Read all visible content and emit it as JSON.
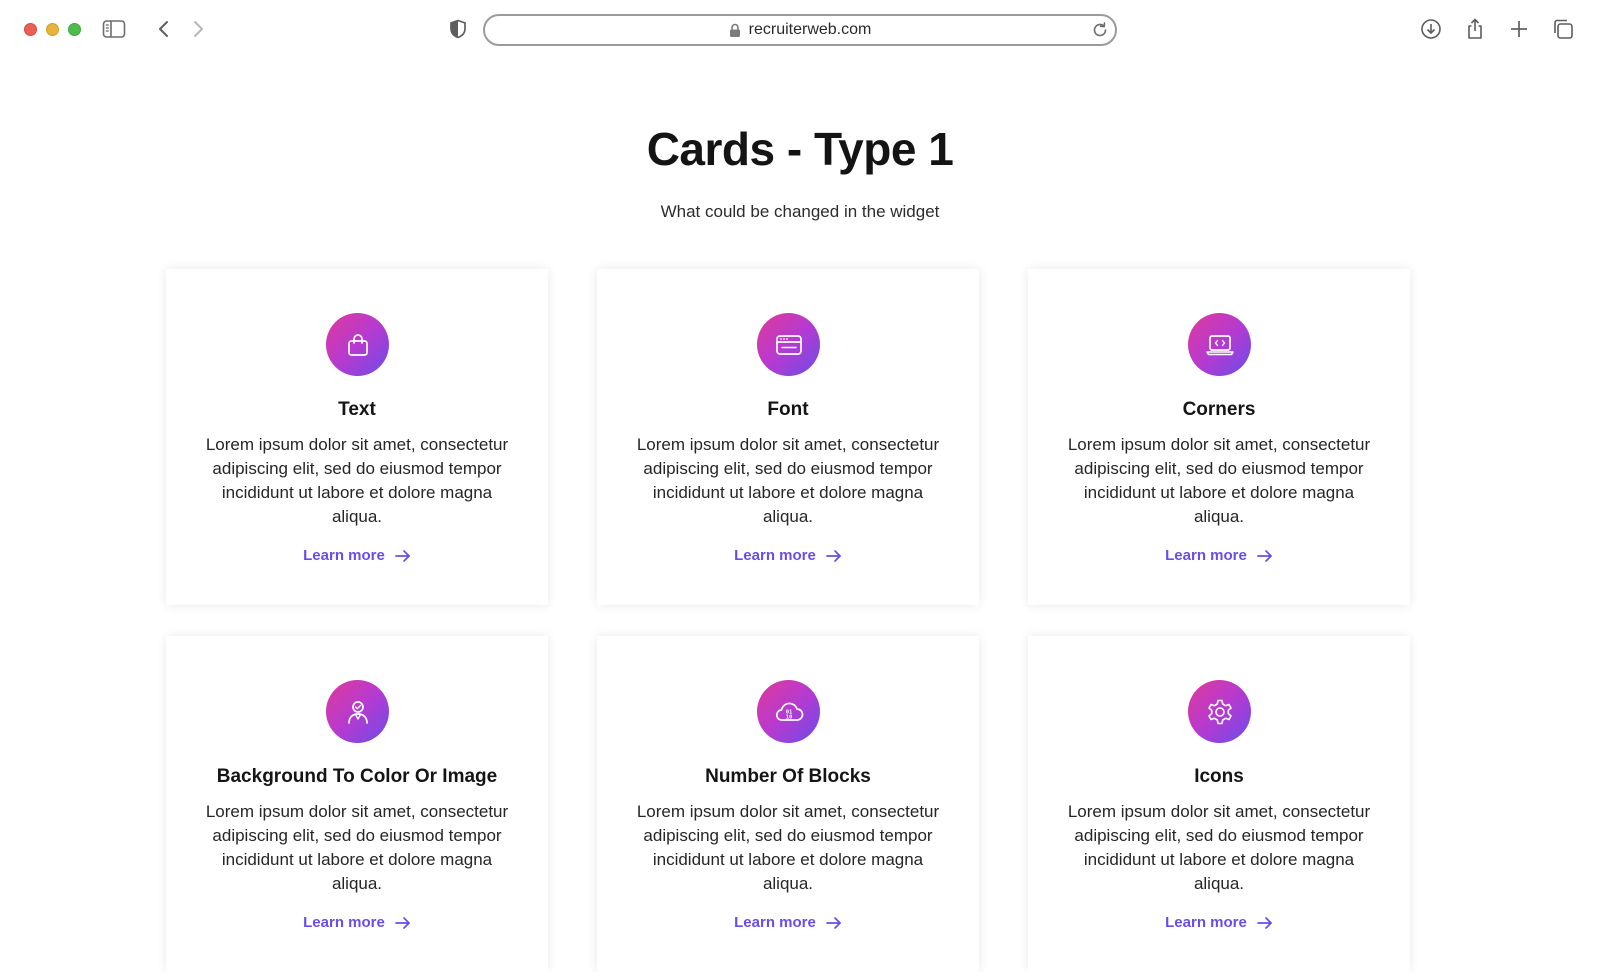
{
  "browser": {
    "url": "recruiterweb.com"
  },
  "page": {
    "title": "Cards - Type 1",
    "subtitle": "What could be changed in the widget"
  },
  "colors": {
    "accent": "#6a4de8",
    "gradient_start": "#e0399a",
    "gradient_end": "#6a4de8"
  },
  "cards": [
    {
      "icon": "shopping-bag-icon",
      "title": "Text",
      "description": "Lorem ipsum dolor sit amet, consectetur adipiscing elit, sed do eiusmod tempor incididunt ut labore et dolore magna aliqua.",
      "link": "Learn more"
    },
    {
      "icon": "browser-window-icon",
      "title": "Font",
      "description": "Lorem ipsum dolor sit amet, consectetur adipiscing elit, sed do eiusmod tempor incididunt ut labore et dolore magna aliqua.",
      "link": "Learn more"
    },
    {
      "icon": "laptop-code-icon",
      "title": "Corners",
      "description": "Lorem ipsum dolor sit amet, consectetur adipiscing elit, sed do eiusmod tempor incididunt ut labore et dolore magna aliqua.",
      "link": "Learn more"
    },
    {
      "icon": "user-icon",
      "title": "Background To Color Or Image",
      "description": "Lorem ipsum dolor sit amet, consectetur adipiscing elit, sed do eiusmod tempor incididunt ut labore et dolore magna aliqua.",
      "link": "Learn more"
    },
    {
      "icon": "cloud-binary-icon",
      "title": "Number Of Blocks",
      "description": "Lorem ipsum dolor sit amet, consectetur adipiscing elit, sed do eiusmod tempor incididunt ut labore et dolore magna aliqua.",
      "link": "Learn more"
    },
    {
      "icon": "gear-icon",
      "title": "Icons",
      "description": "Lorem ipsum dolor sit amet, consectetur adipiscing elit, sed do eiusmod tempor incididunt ut labore et dolore magna aliqua.",
      "link": "Learn more"
    }
  ]
}
